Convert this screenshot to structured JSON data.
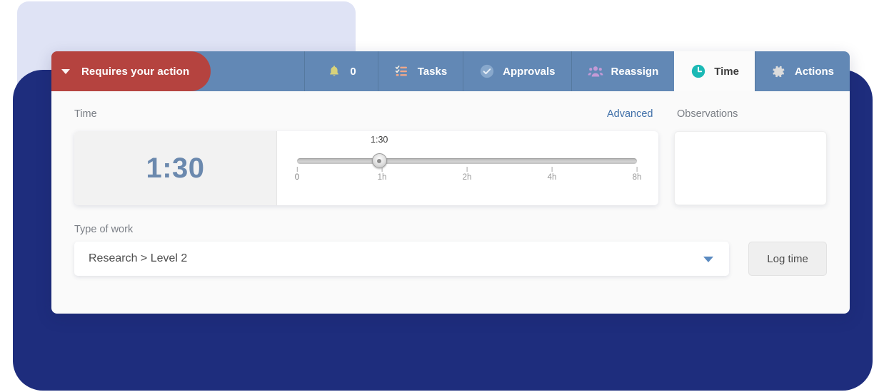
{
  "alert": {
    "label": "Requires your action",
    "caret_icon": "chevron-down-icon"
  },
  "tabs": [
    {
      "id": "notifications",
      "label": "0",
      "icon": "bell-icon",
      "active": false
    },
    {
      "id": "tasks",
      "label": "Tasks",
      "icon": "checklist-icon",
      "active": false
    },
    {
      "id": "approvals",
      "label": "Approvals",
      "icon": "check-circle-icon",
      "active": false
    },
    {
      "id": "reassign",
      "label": "Reassign",
      "icon": "people-group-icon",
      "active": false
    },
    {
      "id": "time",
      "label": "Time",
      "icon": "clock-icon",
      "active": true
    },
    {
      "id": "actions",
      "label": "Actions",
      "icon": "gear-icon",
      "active": false
    }
  ],
  "time_section": {
    "label": "Time",
    "advanced_link": "Advanced",
    "observations_label": "Observations",
    "observations_value": "",
    "observations_placeholder": "",
    "display_value": "1:30"
  },
  "slider": {
    "value_label": "1:30",
    "value_fraction": 0.242,
    "ticks": [
      {
        "label": "0",
        "position": 0
      },
      {
        "label": "1h",
        "position": 25
      },
      {
        "label": "2h",
        "position": 50
      },
      {
        "label": "4h",
        "position": 75
      },
      {
        "label": "8h",
        "position": 100
      }
    ]
  },
  "work": {
    "label": "Type of work",
    "selected": "Research > Level 2",
    "caret_icon": "chevron-down-icon",
    "log_button": "Log time"
  },
  "colors": {
    "header_blue": "#6288b5",
    "alert_red": "#b5433f",
    "navy_backdrop": "#1e2d7d",
    "lavender_backdrop": "#dfe3f5",
    "time_value_blue": "#6b89ae",
    "clock_teal": "#1bb9b5",
    "link_blue": "#3f6fa8"
  }
}
